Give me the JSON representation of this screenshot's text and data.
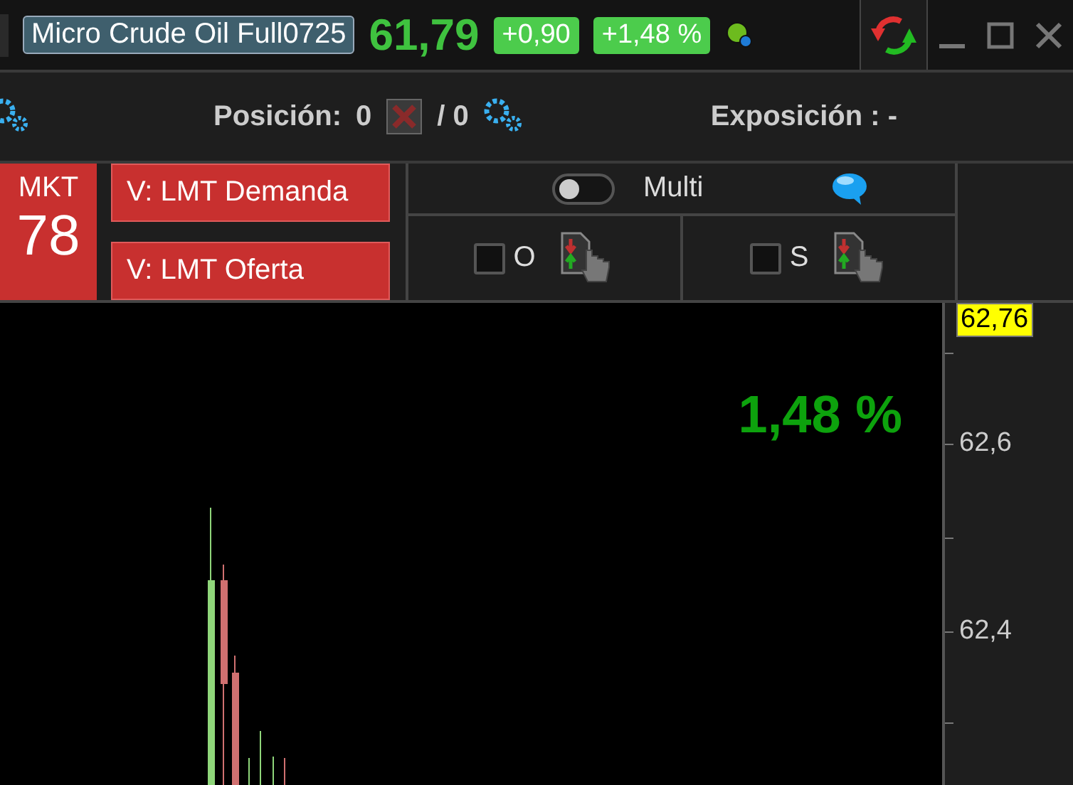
{
  "header": {
    "instrument": "Micro Crude Oil Full0725",
    "price": "61,79",
    "change": "+0,90",
    "change_pct": "+1,48 %"
  },
  "position_bar": {
    "position_label": "Posición:",
    "position_value": "0",
    "position_total": "/ 0",
    "exposure": "Exposición : -"
  },
  "order_panel": {
    "market_button": {
      "label": "MKT",
      "price": "78"
    },
    "buttons": [
      "V: LMT Demanda",
      "V: LMT Oferta"
    ],
    "multi": {
      "label": "Multi",
      "on": false
    },
    "options": [
      {
        "label": "O",
        "checked": false
      },
      {
        "label": "S",
        "checked": false
      }
    ]
  },
  "chart": {
    "change_overlay": "1,48 %",
    "price_marker": "62,76",
    "axis_labels": [
      "62,6",
      "62,4"
    ]
  }
}
